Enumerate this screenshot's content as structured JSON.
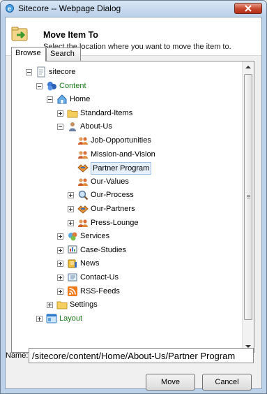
{
  "window": {
    "title": "Sitecore -- Webpage Dialog"
  },
  "header": {
    "title": "Move Item To",
    "subtitle": "Select the location where you want to move the item to."
  },
  "tabs": [
    {
      "label": "Browse",
      "active": true
    },
    {
      "label": "Search",
      "active": false
    }
  ],
  "tree": [
    {
      "label": "sitecore",
      "expander": "minus",
      "icon": "document-icon",
      "color": "#000000"
    },
    {
      "label": "Content",
      "expander": "minus",
      "icon": "content-icon",
      "color": "#1a7a1a"
    },
    {
      "label": "Home",
      "expander": "minus",
      "icon": "home-icon",
      "color": "#000000"
    },
    {
      "label": "Standard-Items",
      "expander": "plus",
      "icon": "folder-icon",
      "color": "#000000"
    },
    {
      "label": "About-Us",
      "expander": "minus",
      "icon": "person-icon",
      "color": "#000000"
    },
    {
      "label": "Job-Opportunities",
      "expander": "none",
      "icon": "people-icon",
      "color": "#000000"
    },
    {
      "label": "Mission-and-Vision",
      "expander": "none",
      "icon": "people-icon",
      "color": "#000000"
    },
    {
      "label": "Partner Program",
      "expander": "none",
      "icon": "handshake-icon",
      "color": "#000000",
      "selected": true
    },
    {
      "label": "Our-Values",
      "expander": "none",
      "icon": "people-icon",
      "color": "#000000"
    },
    {
      "label": "Our-Process",
      "expander": "plus",
      "icon": "magnifier-icon",
      "color": "#000000"
    },
    {
      "label": "Our-Partners",
      "expander": "plus",
      "icon": "handshake-icon",
      "color": "#000000"
    },
    {
      "label": "Press-Lounge",
      "expander": "plus",
      "icon": "people-icon",
      "color": "#000000"
    },
    {
      "label": "Services",
      "expander": "plus",
      "icon": "services-icon",
      "color": "#000000"
    },
    {
      "label": "Case-Studies",
      "expander": "plus",
      "icon": "presentation-icon",
      "color": "#000000"
    },
    {
      "label": "News",
      "expander": "plus",
      "icon": "news-icon",
      "color": "#000000"
    },
    {
      "label": "Contact-Us",
      "expander": "plus",
      "icon": "contact-icon",
      "color": "#000000"
    },
    {
      "label": "RSS-Feeds",
      "expander": "plus",
      "icon": "rss-icon",
      "color": "#000000"
    },
    {
      "label": "Settings",
      "expander": "plus",
      "icon": "folder-icon",
      "color": "#000000"
    },
    {
      "label": "Layout",
      "expander": "plus",
      "icon": "layout-icon",
      "color": "#1a7a1a"
    }
  ],
  "name_field": {
    "label": "Name:",
    "value": "/sitecore/content/Home/About-Us/Partner Program"
  },
  "buttons": {
    "move": "Move",
    "cancel": "Cancel"
  }
}
